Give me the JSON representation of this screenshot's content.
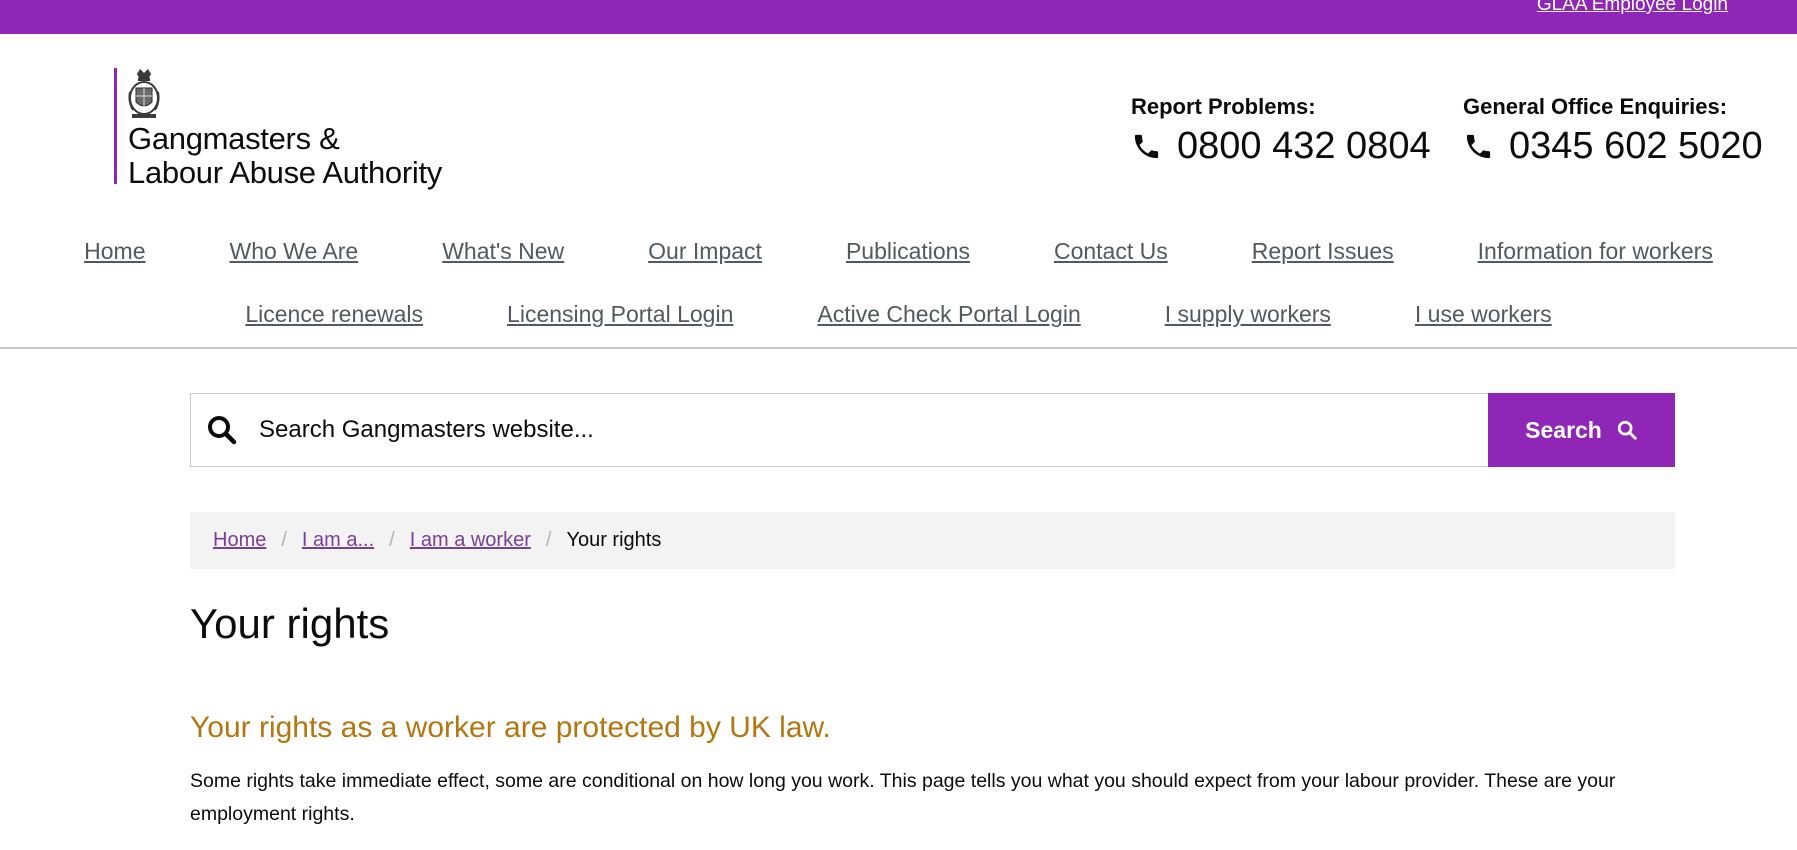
{
  "topbar": {
    "employee_login": "GLAA Employee Login",
    "color": "#9026b8"
  },
  "logo": {
    "line1": "Gangmasters &",
    "line2": "Labour Abuse Authority",
    "icon": "royal-crest-icon"
  },
  "contacts": [
    {
      "label": "Report Problems:",
      "phone": "0800 432 0804",
      "icon": "phone-icon"
    },
    {
      "label": "General Office Enquiries:",
      "phone": "0345 602 5020",
      "icon": "phone-icon"
    }
  ],
  "nav": {
    "row1": [
      "Home",
      "Who We Are",
      "What's New",
      "Our Impact",
      "Publications",
      "Contact Us",
      "Report Issues",
      "Information for workers"
    ],
    "row2": [
      "Licence renewals",
      "Licensing Portal Login",
      "Active Check Portal Login",
      "I supply workers",
      "I use workers"
    ]
  },
  "search": {
    "placeholder": "Search Gangmasters website...",
    "button_label": "Search",
    "icon": "search-icon"
  },
  "breadcrumb": {
    "links": [
      "Home",
      "I am a...",
      "I am a worker"
    ],
    "current": "Your rights",
    "separator": "/"
  },
  "page": {
    "title": "Your rights",
    "subtitle": "Your rights as a worker are protected by UK law.",
    "intro": "Some rights take immediate effect, some are conditional on how long you work. This page tells you what you should expect from your labour provider. These are your employment rights."
  },
  "colors": {
    "brand_purple": "#9026b8",
    "link_purple": "#7b3f97",
    "subtitle_amber": "#b5750f",
    "nav_grey": "#505a5f"
  }
}
